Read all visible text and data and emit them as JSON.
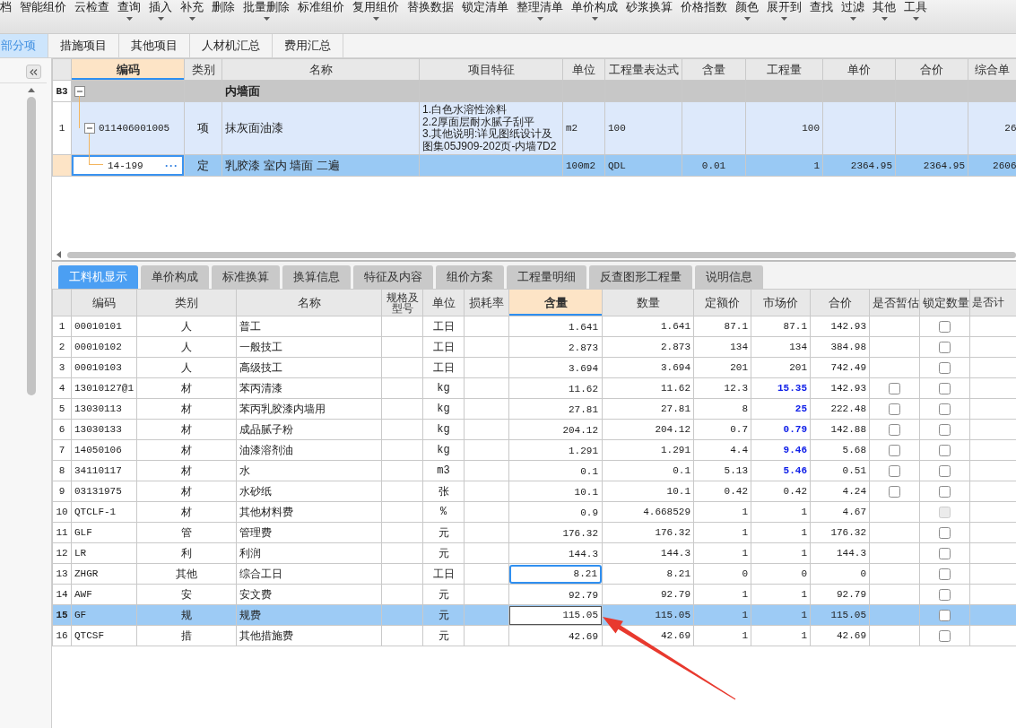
{
  "toolbar": {
    "items": [
      {
        "label": "档",
        "dropdown": false
      },
      {
        "label": "智能组价",
        "dropdown": false
      },
      {
        "label": "云检查",
        "dropdown": false
      },
      {
        "label": "查询",
        "dropdown": true
      },
      {
        "label": "插入",
        "dropdown": true
      },
      {
        "label": "补充",
        "dropdown": true
      },
      {
        "label": "删除",
        "dropdown": false
      },
      {
        "label": "批量删除",
        "dropdown": true
      },
      {
        "label": "标准组价",
        "dropdown": false
      },
      {
        "label": "复用组价",
        "dropdown": true
      },
      {
        "label": "替换数据",
        "dropdown": false
      },
      {
        "label": "锁定清单",
        "dropdown": false
      },
      {
        "label": "整理清单",
        "dropdown": true
      },
      {
        "label": "单价构成",
        "dropdown": true
      },
      {
        "label": "砂浆换算",
        "dropdown": false
      },
      {
        "label": "价格指数",
        "dropdown": false
      },
      {
        "label": "颜色",
        "dropdown": true
      },
      {
        "label": "展开到",
        "dropdown": true
      },
      {
        "label": "查找",
        "dropdown": false
      },
      {
        "label": "过滤",
        "dropdown": true
      },
      {
        "label": "其他",
        "dropdown": true
      },
      {
        "label": "工具",
        "dropdown": true
      }
    ]
  },
  "module_tabs": [
    {
      "label": "部分项",
      "selected": true
    },
    {
      "label": "措施项目",
      "selected": false
    },
    {
      "label": "其他项目",
      "selected": false
    },
    {
      "label": "人材机汇总",
      "selected": false
    },
    {
      "label": "费用汇总",
      "selected": false
    }
  ],
  "upper_table": {
    "columns": [
      {
        "label": "编码",
        "selected": true
      },
      {
        "label": "类别",
        "selected": false
      },
      {
        "label": "名称",
        "selected": false
      },
      {
        "label": "项目特征",
        "selected": false
      },
      {
        "label": "单位",
        "selected": false
      },
      {
        "label": "工程量表达式",
        "selected": false
      },
      {
        "label": "含量",
        "selected": false
      },
      {
        "label": "工程量",
        "selected": false
      },
      {
        "label": "单价",
        "selected": false
      },
      {
        "label": "合价",
        "selected": false
      },
      {
        "label": "综合单",
        "selected": false
      }
    ],
    "rows": [
      {
        "kind": "group",
        "number": "B3",
        "expanded": true,
        "selected": false,
        "name": "内墙面",
        "children": [
          {
            "kind": "item",
            "number": "1",
            "expanded": true,
            "selected": false,
            "code": "011406001005",
            "type": "项",
            "name": "抹灰面油漆",
            "features": [
              "1.白色水溶性涂料",
              "2.2厚面层耐水腻子刮平",
              "3.其他说明:详见图纸设计及图集05J909-202页-内墙7D2"
            ],
            "unit": "m2",
            "expression": "100",
            "quantity": "100",
            "composite_price": "26",
            "children": [
              {
                "kind": "quota",
                "selected": true,
                "code": "14-199",
                "more": "···",
                "type": "定",
                "name": "乳胶漆 室内 墙面 二遍",
                "unit": "100m2",
                "expression": "QDL",
                "content": "0.01",
                "quantity": "1",
                "unit_price": "2364.95",
                "total": "2364.95",
                "composite_price": "2606"
              }
            ]
          }
        ]
      }
    ]
  },
  "detail_tabs": [
    {
      "label": "工料机显示",
      "selected": true
    },
    {
      "label": "单价构成",
      "selected": false
    },
    {
      "label": "标准换算",
      "selected": false
    },
    {
      "label": "换算信息",
      "selected": false
    },
    {
      "label": "特征及内容",
      "selected": false
    },
    {
      "label": "组价方案",
      "selected": false
    },
    {
      "label": "工程量明细",
      "selected": false
    },
    {
      "label": "反查图形工程量",
      "selected": false
    },
    {
      "label": "说明信息",
      "selected": false
    }
  ],
  "lower_table": {
    "columns": [
      {
        "label": "编码",
        "selected": false
      },
      {
        "label": "类别",
        "selected": false
      },
      {
        "label": "名称",
        "selected": false
      },
      {
        "label": "规格及型号",
        "selected": false
      },
      {
        "label": "单位",
        "selected": false
      },
      {
        "label": "损耗率",
        "selected": false
      },
      {
        "label": "含量",
        "selected": true
      },
      {
        "label": "数量",
        "selected": false
      },
      {
        "label": "定额价",
        "selected": false
      },
      {
        "label": "市场价",
        "selected": false
      },
      {
        "label": "合价",
        "selected": false
      },
      {
        "label": "是否暂估",
        "selected": false
      },
      {
        "label": "锁定数量",
        "selected": false
      },
      {
        "label": "是否计",
        "selected": false
      }
    ],
    "rows": [
      {
        "number": "1",
        "selected": false,
        "code": "00010101",
        "type": "人",
        "name": "普工",
        "unit": "工日",
        "content": "1.641",
        "content_focused": false,
        "amount": "1.641",
        "quota_price": "87.1",
        "market_price": "87.1",
        "price_changed": false,
        "total": "142.93",
        "lock_checked": false,
        "lock_disabled": false
      },
      {
        "number": "2",
        "selected": false,
        "code": "00010102",
        "type": "人",
        "name": "一般技工",
        "unit": "工日",
        "content": "2.873",
        "content_focused": false,
        "amount": "2.873",
        "quota_price": "134",
        "market_price": "134",
        "price_changed": false,
        "total": "384.98",
        "lock_checked": false,
        "lock_disabled": false
      },
      {
        "number": "3",
        "selected": false,
        "code": "00010103",
        "type": "人",
        "name": "高级技工",
        "unit": "工日",
        "content": "3.694",
        "content_focused": false,
        "amount": "3.694",
        "quota_price": "201",
        "market_price": "201",
        "price_changed": false,
        "total": "742.49",
        "lock_checked": false,
        "lock_disabled": false
      },
      {
        "number": "4",
        "selected": false,
        "code": "13010127@1",
        "type": "材",
        "name": "苯丙清漆",
        "unit": "kg",
        "content": "11.62",
        "content_focused": false,
        "amount": "11.62",
        "quota_price": "12.3",
        "market_price": "15.35",
        "price_changed": true,
        "total": "142.93",
        "provisional_checked": false,
        "lock_checked": false,
        "lock_disabled": false
      },
      {
        "number": "5",
        "selected": false,
        "code": "13030113",
        "type": "材",
        "name": "苯丙乳胶漆内墙用",
        "unit": "kg",
        "content": "27.81",
        "content_focused": false,
        "amount": "27.81",
        "quota_price": "8",
        "market_price": "25",
        "price_changed": true,
        "total": "222.48",
        "provisional_checked": false,
        "lock_checked": false,
        "lock_disabled": false
      },
      {
        "number": "6",
        "selected": false,
        "code": "13030133",
        "type": "材",
        "name": "成品腻子粉",
        "unit": "kg",
        "content": "204.12",
        "content_focused": false,
        "amount": "204.12",
        "quota_price": "0.7",
        "market_price": "0.79",
        "price_changed": true,
        "total": "142.88",
        "provisional_checked": false,
        "lock_checked": false,
        "lock_disabled": false
      },
      {
        "number": "7",
        "selected": false,
        "code": "14050106",
        "type": "材",
        "name": "油漆溶剂油",
        "unit": "kg",
        "content": "1.291",
        "content_focused": false,
        "amount": "1.291",
        "quota_price": "4.4",
        "market_price": "9.46",
        "price_changed": true,
        "total": "5.68",
        "provisional_checked": false,
        "lock_checked": false,
        "lock_disabled": false
      },
      {
        "number": "8",
        "selected": false,
        "code": "34110117",
        "type": "材",
        "name": "水",
        "unit": "m3",
        "content": "0.1",
        "content_focused": false,
        "amount": "0.1",
        "quota_price": "5.13",
        "market_price": "5.46",
        "price_changed": true,
        "total": "0.51",
        "provisional_checked": false,
        "lock_checked": false,
        "lock_disabled": false
      },
      {
        "number": "9",
        "selected": false,
        "code": "03131975",
        "type": "材",
        "name": "水砂纸",
        "unit": "张",
        "content": "10.1",
        "content_focused": false,
        "amount": "10.1",
        "quota_price": "0.42",
        "market_price": "0.42",
        "price_changed": false,
        "total": "4.24",
        "provisional_checked": false,
        "lock_checked": false,
        "lock_disabled": false
      },
      {
        "number": "10",
        "selected": false,
        "code": "QTCLF-1",
        "type": "材",
        "name": "其他材料费",
        "unit": "%",
        "content": "0.9",
        "content_focused": false,
        "amount": "4.668529",
        "quota_price": "1",
        "market_price": "1",
        "price_changed": false,
        "total": "4.67",
        "lock_checked": false,
        "lock_disabled": true
      },
      {
        "number": "11",
        "selected": false,
        "code": "GLF",
        "type": "管",
        "name": "管理费",
        "unit": "元",
        "content": "176.32",
        "content_focused": false,
        "amount": "176.32",
        "quota_price": "1",
        "market_price": "1",
        "price_changed": false,
        "total": "176.32",
        "lock_checked": false,
        "lock_disabled": false
      },
      {
        "number": "12",
        "selected": false,
        "code": "LR",
        "type": "利",
        "name": "利润",
        "unit": "元",
        "content": "144.3",
        "content_focused": false,
        "amount": "144.3",
        "quota_price": "1",
        "market_price": "1",
        "price_changed": false,
        "total": "144.3",
        "lock_checked": false,
        "lock_disabled": false
      },
      {
        "number": "13",
        "selected": false,
        "code": "ZHGR",
        "type": "其他",
        "name": "综合工日",
        "unit": "工日",
        "content": "8.21",
        "content_focused": true,
        "amount": "8.21",
        "quota_price": "0",
        "market_price": "0",
        "price_changed": false,
        "total": "0",
        "lock_checked": false,
        "lock_disabled": false
      },
      {
        "number": "14",
        "selected": false,
        "code": "AWF",
        "type": "安",
        "name": "安文费",
        "unit": "元",
        "content": "92.79",
        "content_focused": false,
        "amount": "92.79",
        "quota_price": "1",
        "market_price": "1",
        "price_changed": false,
        "total": "92.79",
        "lock_checked": false,
        "lock_disabled": false
      },
      {
        "number": "15",
        "selected": true,
        "code": "GF",
        "type": "规",
        "name": "规费",
        "unit": "元",
        "content": "115.05",
        "content_focused": false,
        "amount": "115.05",
        "quota_price": "1",
        "market_price": "1",
        "price_changed": false,
        "total": "115.05",
        "lock_checked": false,
        "lock_disabled": false
      },
      {
        "number": "16",
        "selected": false,
        "code": "QTCSF",
        "type": "措",
        "name": "其他措施费",
        "unit": "元",
        "content": "42.69",
        "content_focused": false,
        "amount": "42.69",
        "quota_price": "1",
        "market_price": "1",
        "price_changed": false,
        "total": "42.69",
        "lock_checked": false,
        "lock_disabled": false
      }
    ]
  }
}
